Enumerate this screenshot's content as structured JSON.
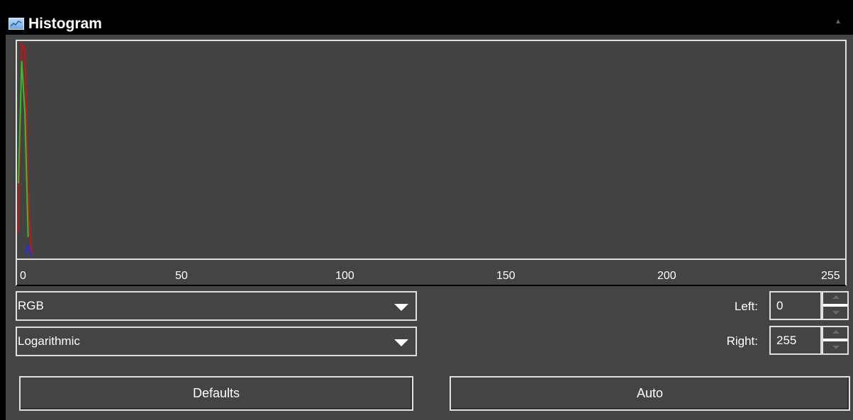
{
  "window": {
    "title": "Histogram",
    "title_icon": "histogram-icon",
    "collapse_icon": "collapse-arrow-icon"
  },
  "chart_data": {
    "type": "line",
    "x_ticks": [
      "0",
      "50",
      "100",
      "150",
      "200",
      "255"
    ],
    "xlim": [
      0,
      255
    ],
    "scale": "Logarithmic",
    "series": [
      {
        "color": "#d01010",
        "values": [
          [
            0,
            0.12
          ],
          [
            1,
            1.0
          ],
          [
            2,
            0.98
          ],
          [
            3,
            0.3
          ],
          [
            4,
            0.02
          ]
        ]
      },
      {
        "color": "#2ec22e",
        "values": [
          [
            0,
            0.35
          ],
          [
            1,
            0.92
          ],
          [
            2,
            0.68
          ],
          [
            3,
            0.1
          ]
        ]
      },
      {
        "color": "#2030e0",
        "values": [
          [
            2,
            0.02
          ],
          [
            3,
            0.06
          ],
          [
            4,
            0.01
          ]
        ]
      }
    ]
  },
  "controls": {
    "channel": "RGB",
    "scale": "Logarithmic",
    "left_label": "Left:",
    "left_value": "0",
    "right_label": "Right:",
    "right_value": "255"
  },
  "buttons": {
    "defaults": "Defaults",
    "auto": "Auto"
  },
  "colors": {
    "background": "#444444",
    "titlebar": "#000000",
    "border": "#e0e0e0"
  }
}
